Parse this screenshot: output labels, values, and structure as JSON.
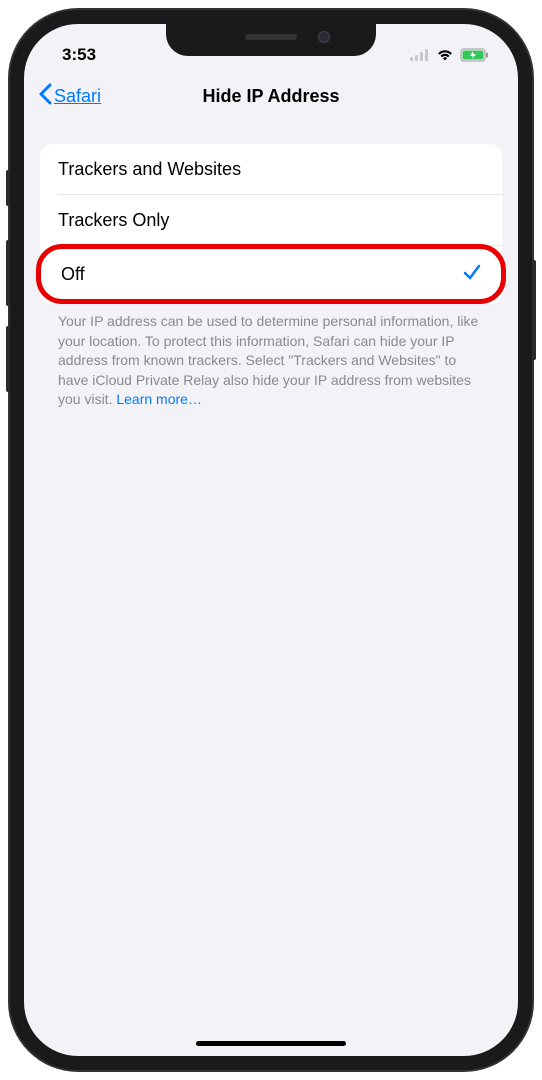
{
  "status": {
    "time": "3:53"
  },
  "nav": {
    "back_label": "Safari",
    "title": "Hide IP Address"
  },
  "options": [
    {
      "label": "Trackers and Websites",
      "selected": false
    },
    {
      "label": "Trackers Only",
      "selected": false
    },
    {
      "label": "Off",
      "selected": true
    }
  ],
  "footer": {
    "text": "Your IP address can be used to determine personal information, like your location. To protect this information, Safari can hide your IP address from known trackers. Select \"Trackers and Websites\" to have iCloud Private Relay also hide your IP address from websites you visit. ",
    "learn_more": "Learn more…"
  }
}
